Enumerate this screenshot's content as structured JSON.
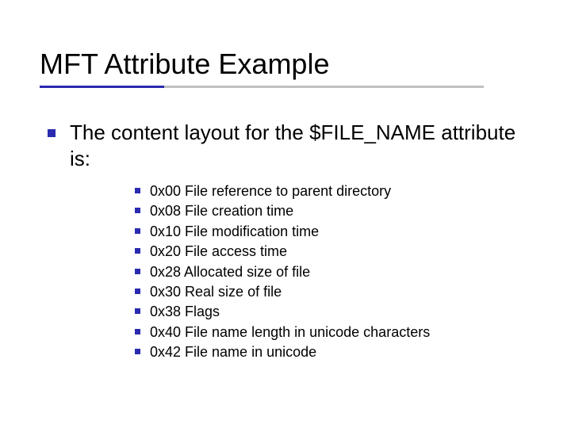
{
  "title": "MFT Attribute Example",
  "main_text": "The content layout for the $FILE_NAME attribute is:",
  "items": [
    "0x00 File reference to parent directory",
    "0x08 File creation time",
    "0x10 File modification time",
    "0x20 File access time",
    "0x28 Allocated size of file",
    "0x30 Real size of file",
    "0x38 Flags",
    "0x40 File name length in unicode characters",
    "0x42 File name in unicode"
  ]
}
